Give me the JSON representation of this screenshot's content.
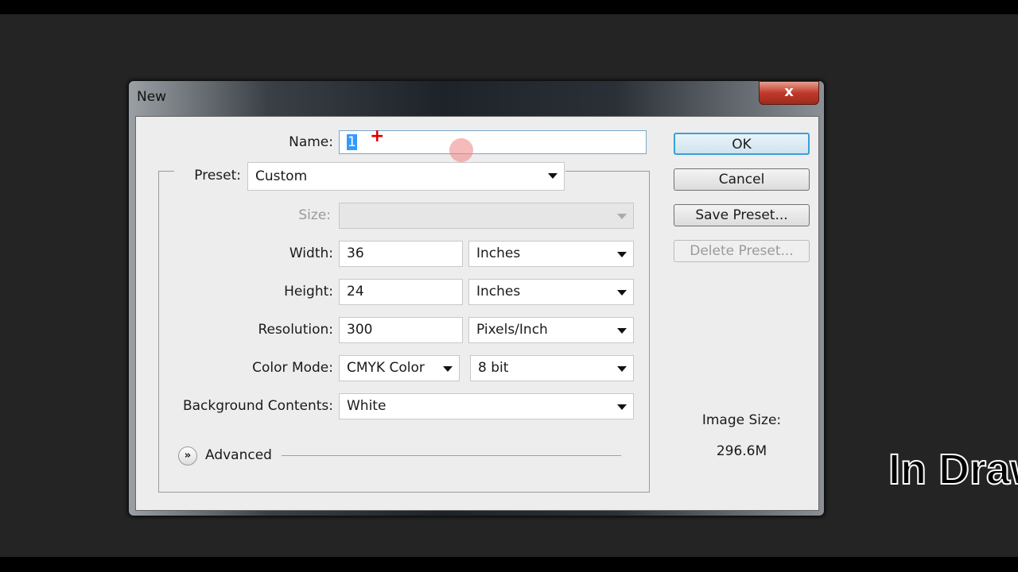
{
  "dialog": {
    "title": "New",
    "close_label": "x"
  },
  "form": {
    "name_label": "Name:",
    "name_value": "1",
    "preset_label": "Preset:",
    "preset_value": "Custom",
    "size_label": "Size:",
    "size_value": "",
    "width_label": "Width:",
    "width_value": "36",
    "width_unit": "Inches",
    "height_label": "Height:",
    "height_value": "24",
    "height_unit": "Inches",
    "resolution_label": "Resolution:",
    "resolution_value": "300",
    "resolution_unit": "Pixels/Inch",
    "color_mode_label": "Color Mode:",
    "color_mode_value": "CMYK Color",
    "bit_depth": "8 bit",
    "background_label": "Background Contents:",
    "background_value": "White",
    "advanced_label": "Advanced"
  },
  "buttons": {
    "ok": "OK",
    "cancel": "Cancel",
    "save_preset": "Save Preset...",
    "delete_preset": "Delete Preset..."
  },
  "info": {
    "image_size_label": "Image Size:",
    "image_size_value": "296.6M"
  },
  "overlay": {
    "watermark": "In Draw"
  }
}
